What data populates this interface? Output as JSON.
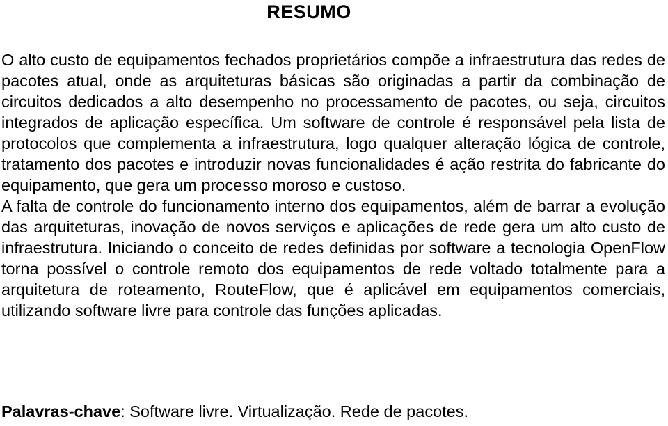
{
  "document": {
    "heading": "RESUMO",
    "language": "pt-BR",
    "text_color": "#000000",
    "background_color": "#ffffff",
    "paragraphs": {
      "p1": "O alto custo de equipamentos fechados proprietários compõe a infraestrutura das redes de pacotes atual, onde as arquiteturas básicas são originadas a partir da combinação de circuitos dedicados a alto desempenho no processamento de pacotes, ou seja, circuitos integrados de aplicação específica. Um software de controle é responsável pela lista de protocolos que complementa a infraestrutura, logo qualquer alteração lógica de controle, tratamento dos pacotes e introduzir novas funcionalidades é ação restrita do fabricante do equipamento, que gera um processo moroso e custoso.",
      "p2": "A falta de controle do funcionamento interno dos equipamentos, além de barrar a evolução das arquiteturas, inovação de novos serviços e aplicações de rede gera um alto custo de infraestrutura. Iniciando o conceito de redes definidas por software a tecnologia OpenFlow torna possível o controle remoto dos equipamentos de rede voltado totalmente para a arquitetura de roteamento, RouteFlow, que é aplicável em equipamentos comerciais, utilizando software livre para controle das funções aplicadas."
    },
    "keywords": {
      "label": "Palavras-chave",
      "separator": ": ",
      "value": "Software livre. Virtualização. Rede de pacotes."
    }
  }
}
